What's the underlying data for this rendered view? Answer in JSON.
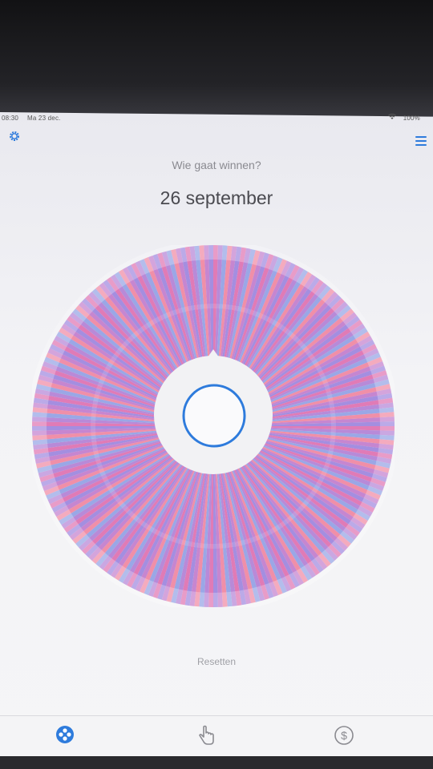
{
  "status": {
    "time": "08:30",
    "date": "Ma 23 dec.",
    "battery": "100%"
  },
  "header": {
    "subtitle": "Wie gaat winnen?",
    "title": "26 september"
  },
  "wheel": {
    "colors": [
      "#e07bb6",
      "#b88ad8",
      "#9aa7e6",
      "#f08fa8",
      "#c686d0",
      "#a48ee0"
    ]
  },
  "actions": {
    "reset_label": "Resetten"
  },
  "tabs": [
    {
      "icon": "wheel-icon",
      "active": true
    },
    {
      "icon": "tap-icon",
      "active": false
    },
    {
      "icon": "dollar-icon",
      "active": false
    }
  ],
  "colors": {
    "accent": "#2e7bdc"
  }
}
